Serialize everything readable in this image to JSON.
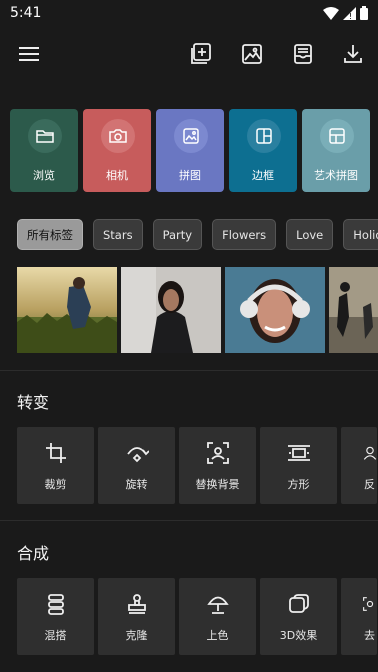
{
  "status_bar": {
    "time": "5:41"
  },
  "quick_actions": [
    {
      "label": "浏览",
      "color": "#2c5a4b",
      "circle": "#3a6b5c",
      "icon": "folder-icon"
    },
    {
      "label": "相机",
      "color": "#c75c5c",
      "circle": "#d27373",
      "icon": "camera-icon"
    },
    {
      "label": "拼图",
      "color": "#6a77c2",
      "circle": "#7c89d0",
      "icon": "image-icon"
    },
    {
      "label": "边框",
      "color": "#0d6f91",
      "circle": "#2a80a0",
      "icon": "frame-icon"
    },
    {
      "label": "艺术拼图",
      "color": "#6a9ea9",
      "circle": "#7aaeb8",
      "icon": "grid-icon"
    }
  ],
  "tags": [
    "所有标签",
    "Stars",
    "Party",
    "Flowers",
    "Love",
    "Holid"
  ],
  "sections": {
    "transform": {
      "title": "转变",
      "tools": [
        "裁剪",
        "旋转",
        "替换背景",
        "方形",
        "反"
      ]
    },
    "compose": {
      "title": "合成",
      "tools": [
        "混搭",
        "克隆",
        "上色",
        "3D效果",
        "去"
      ]
    }
  }
}
